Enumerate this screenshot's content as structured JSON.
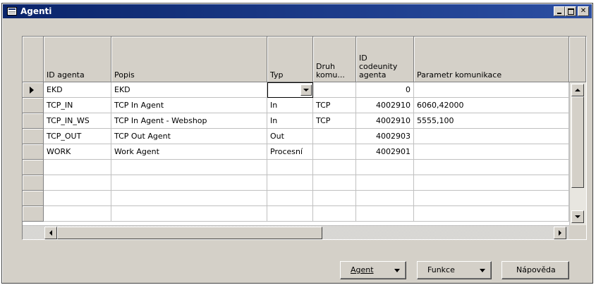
{
  "window": {
    "title": "Agenti"
  },
  "grid": {
    "columns": [
      {
        "key": "id",
        "label": "ID agenta"
      },
      {
        "key": "popis",
        "label": "Popis"
      },
      {
        "key": "typ",
        "label": "Typ"
      },
      {
        "key": "druh",
        "label": "Druh komu..."
      },
      {
        "key": "codeunit",
        "label": "ID codeunity agenta"
      },
      {
        "key": "param",
        "label": "Parametr komunikace"
      }
    ],
    "rows": [
      {
        "id": "EKD",
        "popis": "EKD",
        "typ": "",
        "druh": "",
        "codeunit": "0",
        "param": ""
      },
      {
        "id": "TCP_IN",
        "popis": "TCP In Agent",
        "typ": "In",
        "druh": "TCP",
        "codeunit": "4002910",
        "param": "6060,42000"
      },
      {
        "id": "TCP_IN_WS",
        "popis": "TCP In Agent - Webshop",
        "typ": "In",
        "druh": "TCP",
        "codeunit": "4002910",
        "param": "5555,100"
      },
      {
        "id": "TCP_OUT",
        "popis": "TCP Out Agent",
        "typ": "Out",
        "druh": "",
        "codeunit": "4002903",
        "param": ""
      },
      {
        "id": "WORK",
        "popis": "Work Agent",
        "typ": "Procesní",
        "druh": "",
        "codeunit": "4002901",
        "param": ""
      }
    ],
    "empty_rows": 4
  },
  "buttons": {
    "agent": "Agent",
    "funkce": "Funkce",
    "napoveda": "Nápověda"
  },
  "icons": [
    "table-icon",
    "minimize-icon",
    "maximize-icon",
    "close-icon",
    "row-pointer-icon",
    "dropdown-arrow-icon",
    "scroll-up-icon",
    "scroll-down-icon",
    "scroll-left-icon",
    "scroll-right-icon"
  ],
  "colors": {
    "titlebar": "#0a246a",
    "face": "#d4d0c8"
  }
}
